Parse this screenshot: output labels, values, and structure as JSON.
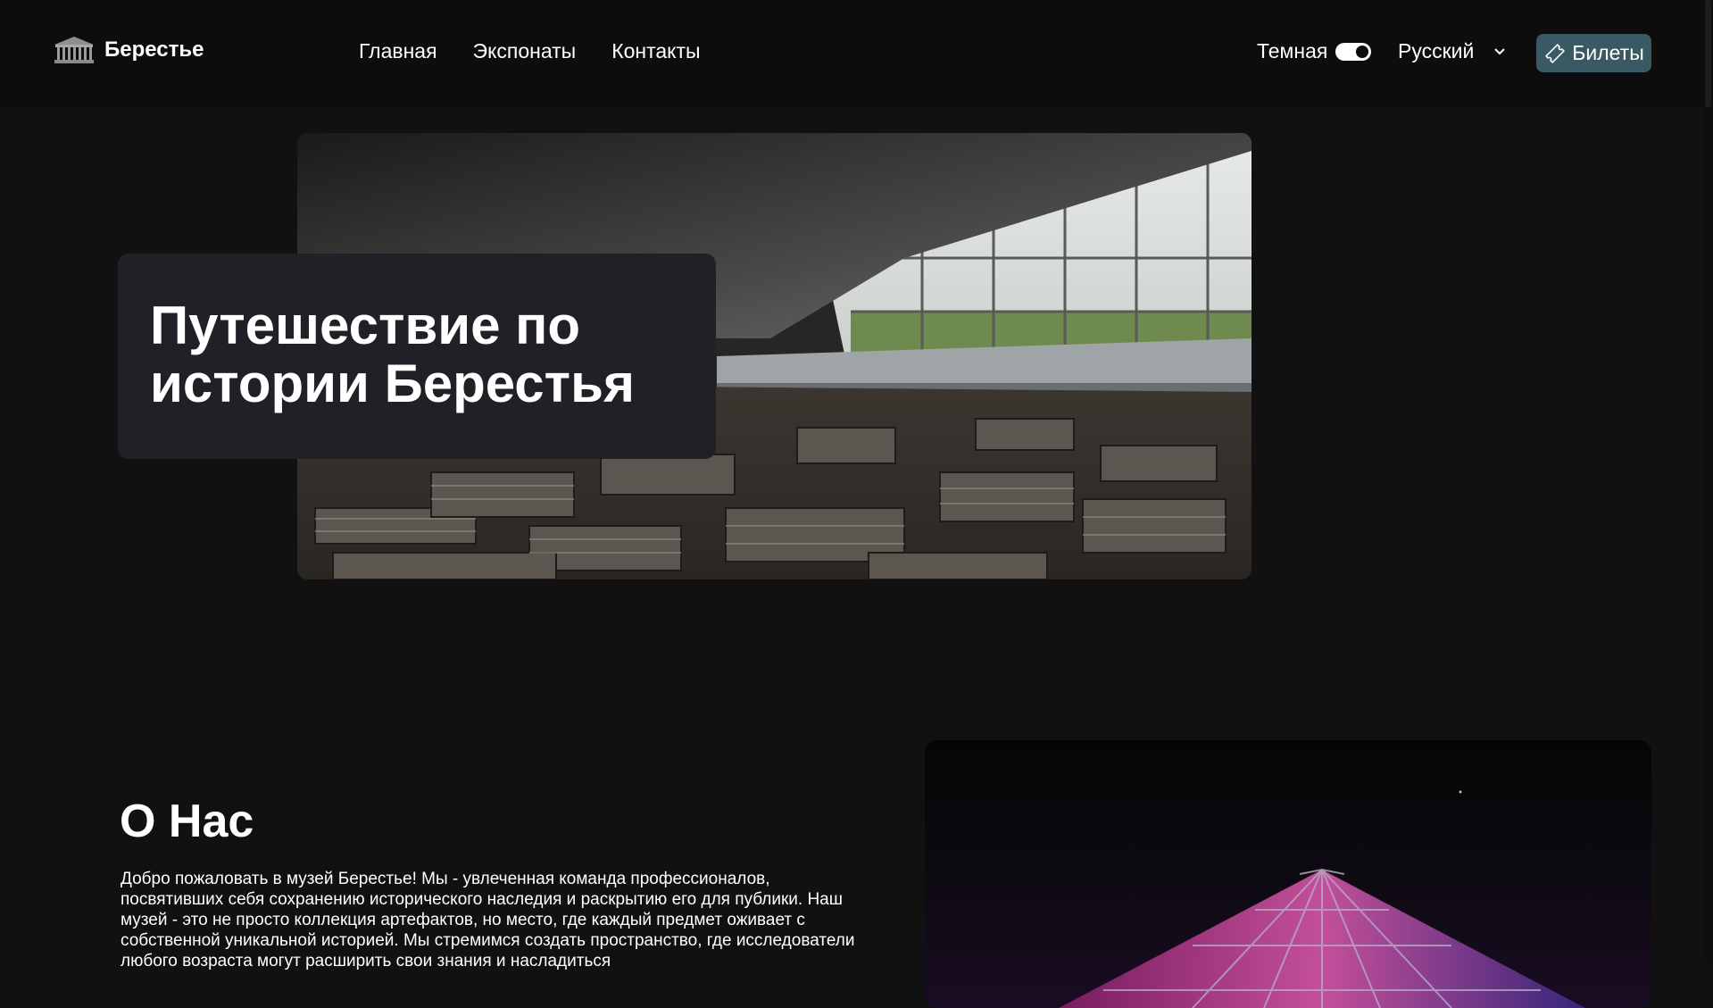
{
  "header": {
    "brand_name": "Берестье",
    "brand_icon": "museum-building-logo",
    "nav": [
      {
        "label": "Главная"
      },
      {
        "label": "Экспонаты"
      },
      {
        "label": "Контакты"
      }
    ],
    "theme_label": "Темная",
    "theme_dark_enabled": true,
    "language": "Русский",
    "tickets_label": "Билеты",
    "tickets_icon": "ticket-icon",
    "colors": {
      "background": "#0d0d0d",
      "tickets_button": "#3a5a63"
    }
  },
  "hero": {
    "title": "Путешествие по истории Берестья",
    "image": "archaeological-excavation-pavilion-photo",
    "card_color": "#1f2126"
  },
  "about": {
    "title": "О Нас",
    "text": "Добро пожаловать в музей Берестье! Мы - увлеченная команда профессионалов, посвятивших себя сохранению исторического наследия и раскрытию его для публики. Наш музей - это не просто коллекция артефактов, но место, где каждый предмет оживает с собственной уникальной историей. Мы стремимся создать пространство, где исследователи любого возраста могут расширить свои знания и насладиться",
    "image": "museum-pyramid-night-photo"
  },
  "page": {
    "background": "#111111"
  }
}
